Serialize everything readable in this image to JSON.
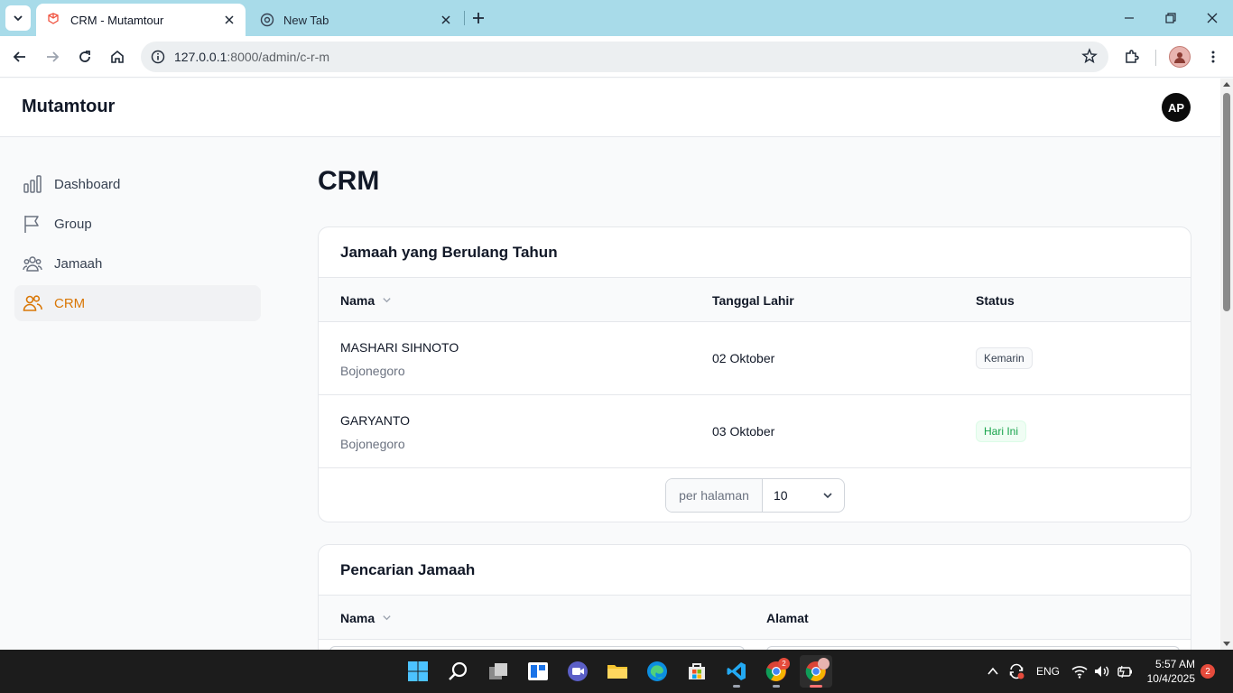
{
  "browser": {
    "tabs": [
      {
        "title": "CRM - Mutamtour",
        "active": true
      },
      {
        "title": "New Tab",
        "active": false
      }
    ],
    "url_host": "127.0.0.1",
    "url_path": ":8000/admin/c-r-m"
  },
  "app": {
    "brand": "Mutamtour",
    "user_initials": "AP",
    "accent_color": "#d97706"
  },
  "sidebar": {
    "items": [
      {
        "label": "Dashboard",
        "icon": "bar-chart-icon",
        "active": false
      },
      {
        "label": "Group",
        "icon": "flag-icon",
        "active": false
      },
      {
        "label": "Jamaah",
        "icon": "users-group-icon",
        "active": false
      },
      {
        "label": "CRM",
        "icon": "users-icon",
        "active": true
      }
    ]
  },
  "main": {
    "title": "CRM",
    "birthday_table": {
      "title": "Jamaah yang Berulang Tahun",
      "columns": [
        "Nama",
        "Tanggal Lahir",
        "Status"
      ],
      "rows": [
        {
          "name": "MASHARI SIHNOTO",
          "city": "Bojonegoro",
          "birth_date": "02 Oktober",
          "status": "Kemarin"
        },
        {
          "name": "GARYANTO",
          "city": "Bojonegoro",
          "birth_date": "03 Oktober",
          "status": "Hari Ini"
        }
      ],
      "per_page_label": "per halaman",
      "per_page_value": "10"
    },
    "search_table": {
      "title": "Pencarian Jamaah",
      "columns": [
        "Nama",
        "Alamat"
      ]
    }
  },
  "taskbar": {
    "apps": [
      "windows-start",
      "search",
      "task-view",
      "widgets",
      "teams",
      "file-explorer",
      "edge",
      "store",
      "vscode",
      "chrome",
      "chrome-profile"
    ],
    "chrome_badge": "2",
    "language": "ENG",
    "time": "5:57 AM",
    "date": "10/4/2025",
    "notification_count": "2"
  }
}
